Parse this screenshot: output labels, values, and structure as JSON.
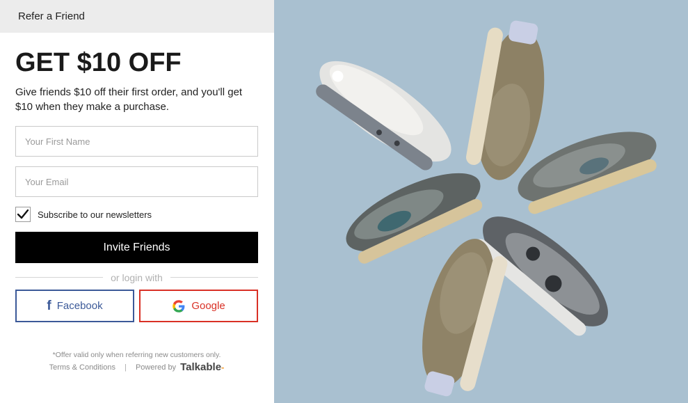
{
  "header": {
    "title": "Refer a Friend"
  },
  "hero": {
    "headline": "GET $10 OFF",
    "subtitle": "Give friends $10 off their first order, and you'll get $10 when they make a purchase."
  },
  "form": {
    "first_name_placeholder": "Your First Name",
    "email_placeholder": "Your Email",
    "subscribe_label": "Subscribe to our newsletters",
    "subscribe_checked": true,
    "invite_label": "Invite Friends",
    "divider_label": "or login with"
  },
  "social": {
    "facebook_label": "Facebook",
    "google_label": "Google"
  },
  "footer": {
    "offer_note": "*Offer valid only when referring new customers only.",
    "terms_label": "Terms & Conditions",
    "separator": "|",
    "powered_by": "Powered by",
    "brand": "Talkable"
  },
  "colors": {
    "facebook": "#3b5998",
    "google": "#d93025",
    "image_background": "#a9c0d0"
  },
  "image": {
    "subject": "sneakers arranged in a circle"
  }
}
